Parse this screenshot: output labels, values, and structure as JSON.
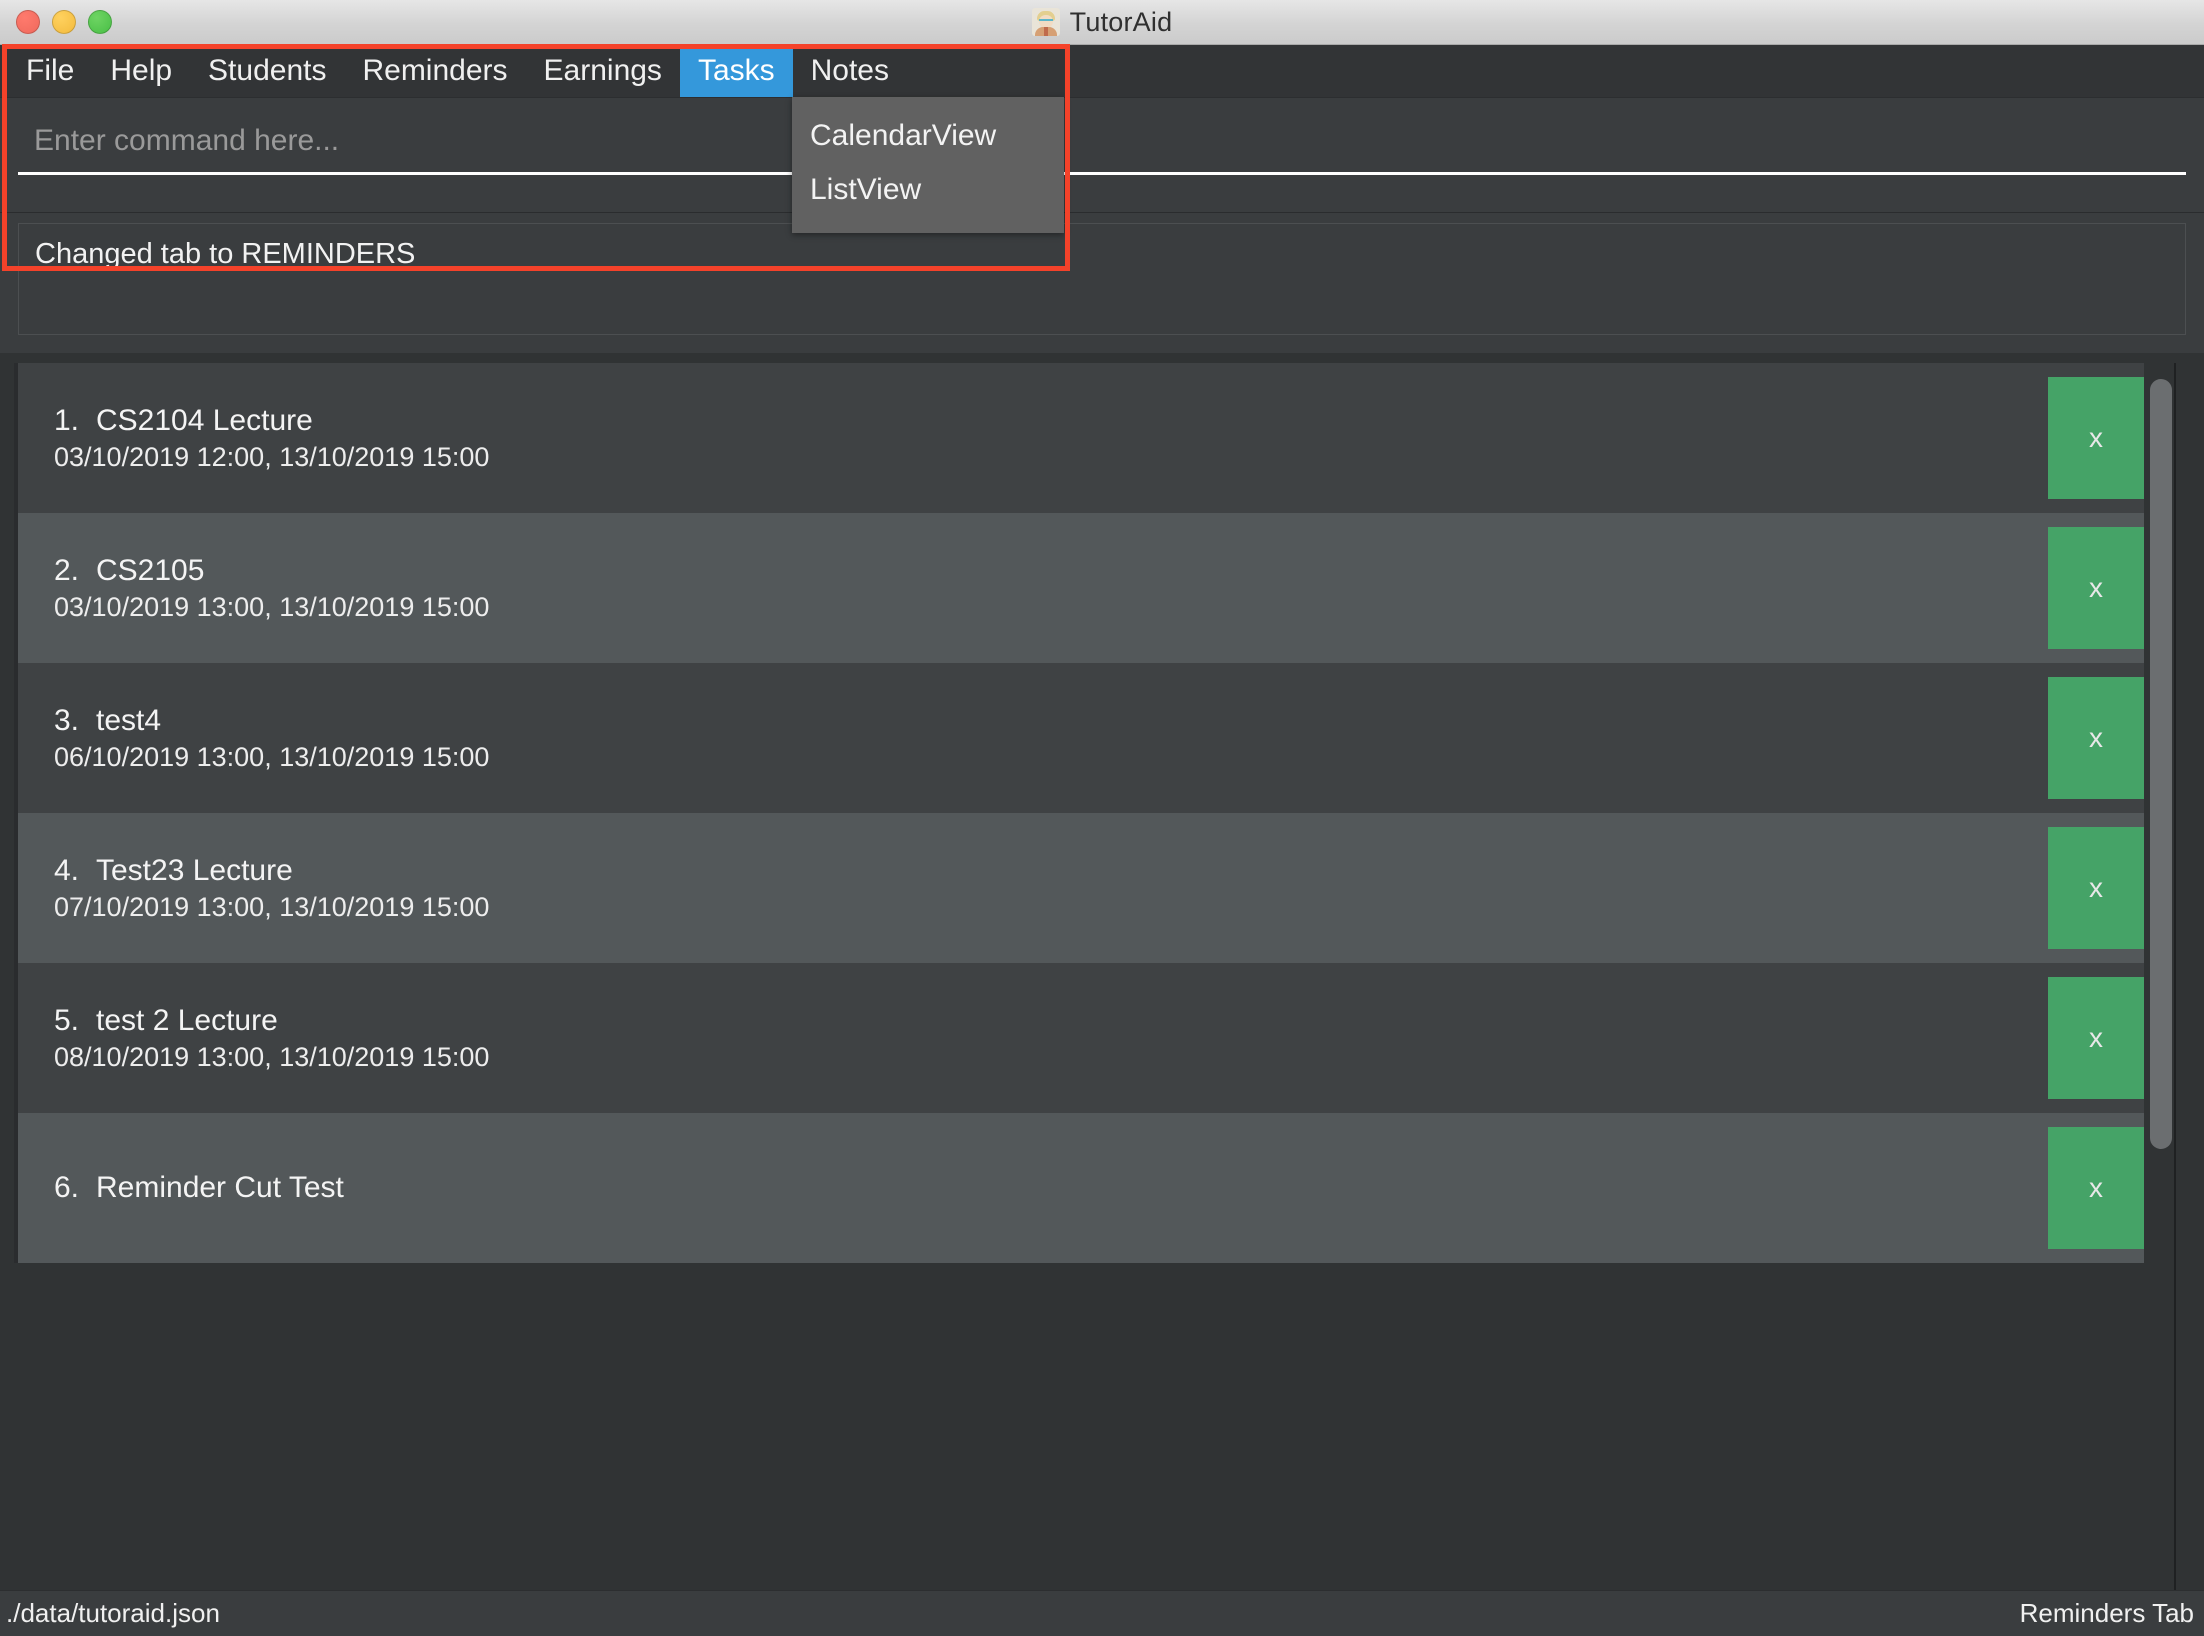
{
  "window": {
    "title": "TutorAid",
    "icon": "tutor-avatar-icon",
    "controls": {
      "close": "close",
      "minimize": "minimize",
      "maximize": "maximize"
    }
  },
  "menubar": {
    "items": [
      {
        "label": "File",
        "active": false
      },
      {
        "label": "Help",
        "active": false
      },
      {
        "label": "Students",
        "active": false
      },
      {
        "label": "Reminders",
        "active": false
      },
      {
        "label": "Earnings",
        "active": false
      },
      {
        "label": "Tasks",
        "active": true
      },
      {
        "label": "Notes",
        "active": false
      }
    ],
    "active_accent": "#3498db"
  },
  "dropdown": {
    "owner": "Tasks",
    "items": [
      {
        "label": "CalendarView"
      },
      {
        "label": "ListView"
      }
    ]
  },
  "command": {
    "placeholder": "Enter command here...",
    "value": ""
  },
  "result": {
    "text": "Changed tab to REMINDERS"
  },
  "list": {
    "rows": [
      {
        "index": "1.",
        "title": "CS2104 Lecture",
        "dates": "03/10/2019 12:00, 13/10/2019 15:00",
        "delete_label": "x"
      },
      {
        "index": "2.",
        "title": "CS2105",
        "dates": "03/10/2019 13:00, 13/10/2019 15:00",
        "delete_label": "x"
      },
      {
        "index": "3.",
        "title": "test4",
        "dates": "06/10/2019 13:00, 13/10/2019 15:00",
        "delete_label": "x"
      },
      {
        "index": "4.",
        "title": "Test23 Lecture",
        "dates": "07/10/2019 13:00, 13/10/2019 15:00",
        "delete_label": "x"
      },
      {
        "index": "5.",
        "title": "test 2 Lecture",
        "dates": "08/10/2019 13:00, 13/10/2019 15:00",
        "delete_label": "x"
      },
      {
        "index": "6.",
        "title": "Reminder Cut Test",
        "dates": "",
        "delete_label": "x"
      }
    ],
    "delete_button_color": "#45a367"
  },
  "statusbar": {
    "file_path": "./data/tutoraid.json",
    "tab_label": "Reminders Tab"
  },
  "annotation": {
    "color": "#f4422a"
  }
}
